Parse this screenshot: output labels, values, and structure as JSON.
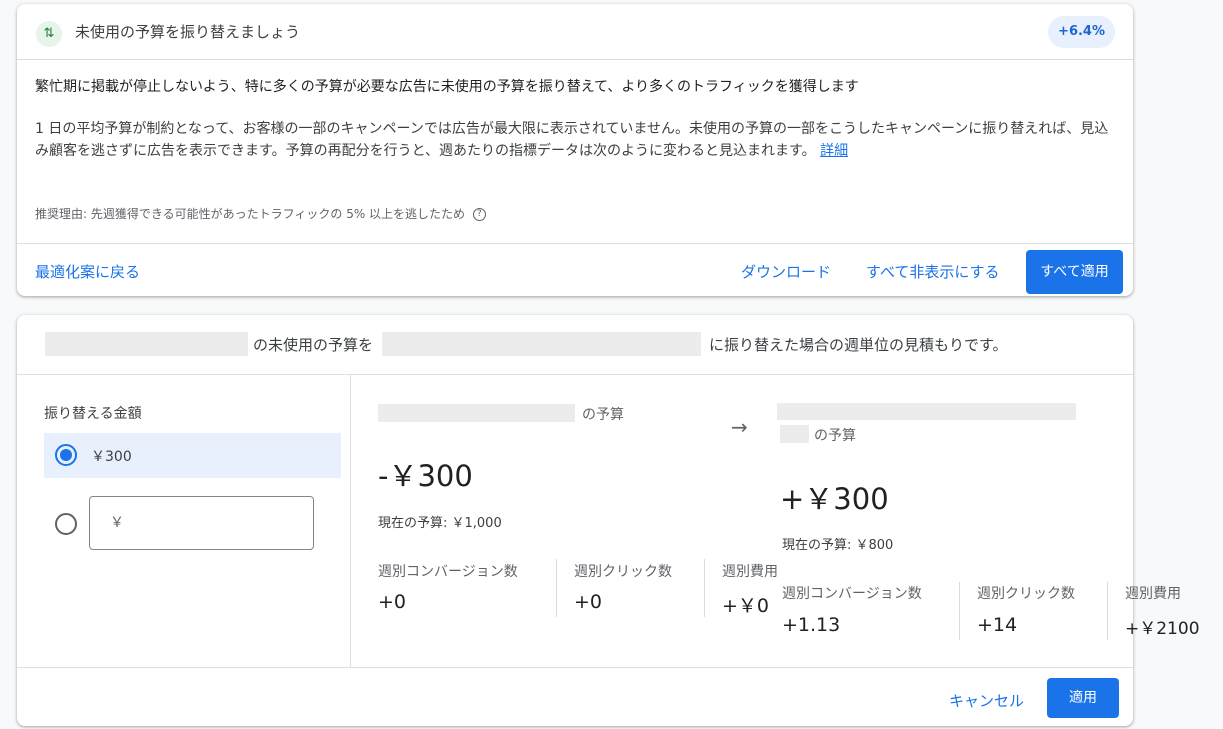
{
  "recommendation": {
    "title": "未使用の予算を振り替えましょう",
    "badge": "+6.4%",
    "lead": "繁忙期に掲載が停止しないよう、特に多くの予算が必要な広告に未使用の予算を振り替えて、より多くのトラフィックを獲得します",
    "body": "1 日の平均予算が制約となって、お客様の一部のキャンペーンでは広告が最大限に表示されていません。未使用の予算の一部をこうしたキャンペーンに振り替えれば、見込み顧客を逃さずに広告を表示できます。予算の再配分を行うと、週あたりの指標データは次のように変わると見込まれます。",
    "details_link": "詳細",
    "reason": "推奨理由: 先週獲得できる可能性があったトラフィックの 5% 以上を逃したため",
    "help_icon_glyph": "?",
    "back_link": "最適化案に戻る",
    "download": "ダウンロード",
    "hide_all": "すべて非表示にする",
    "apply_all": "すべて適用"
  },
  "estimate": {
    "header_mid": "の未使用の予算を",
    "header_end": "に振り替えた場合の週単位の見積もりです。",
    "amount_label": "振り替える金額",
    "options": [
      {
        "label": "￥300",
        "selected": true
      },
      {
        "label": "",
        "selected": false
      }
    ],
    "input_prefix": "￥",
    "arrow": "→",
    "source": {
      "budget_suffix": "の予算",
      "change": "-￥300",
      "current_budget": "現在の予算: ￥1,000",
      "metrics": [
        {
          "label": "週別コンバージョン数",
          "value": "+0"
        },
        {
          "label": "週別クリック数",
          "value": "+0"
        },
        {
          "label": "週別費用",
          "value": "+￥0"
        }
      ]
    },
    "target": {
      "budget_suffix": "の予算",
      "change": "+￥300",
      "current_budget": "現在の予算: ￥800",
      "metrics": [
        {
          "label": "週別コンバージョン数",
          "value": "+1.13"
        },
        {
          "label": "週別クリック数",
          "value": "+14"
        },
        {
          "label": "週別費用",
          "value": "+￥2100"
        }
      ]
    },
    "cancel": "キャンセル",
    "apply": "適用"
  },
  "colors": {
    "accent": "#1a73e8",
    "success": "#188038",
    "selected_bg": "#e8f0fe",
    "redacted": "#ececec"
  }
}
